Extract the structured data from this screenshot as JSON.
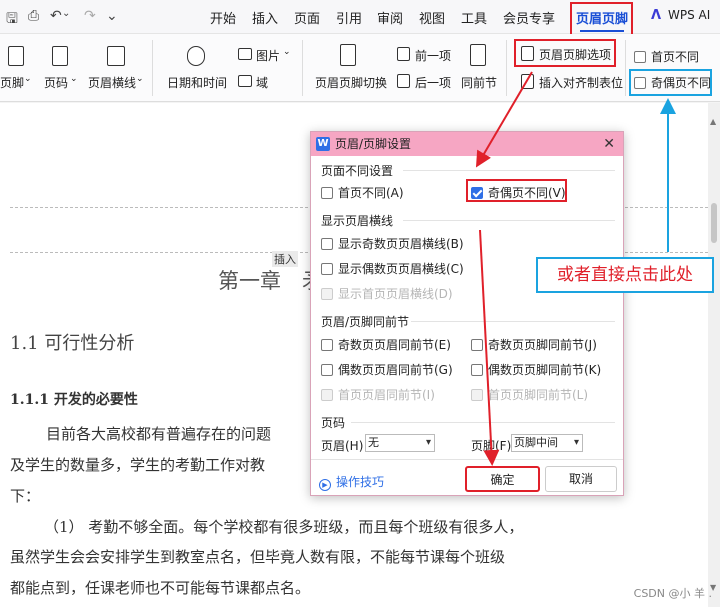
{
  "toolbar": {
    "quick_access": [
      "🖫",
      "↶",
      "⌄",
      "↷",
      "⌄"
    ],
    "tabs": [
      "开始",
      "插入",
      "页面",
      "引用",
      "审阅",
      "视图",
      "工具",
      "会员专享",
      "页眉页脚",
      "WPS AI"
    ],
    "active_tab": "页眉页脚"
  },
  "ribbon": {
    "buttons": [
      "页脚",
      "页码",
      "页眉横线",
      "日期和时间",
      "图片",
      "域",
      "页眉页脚切换",
      "前一项",
      "后一项",
      "同前节",
      "页眉页脚选项",
      "插入对齐制表位",
      "首页不同",
      "奇偶页不同"
    ],
    "dropdown_markers": [
      "⌄",
      "⌄",
      "⌄",
      "⌄"
    ]
  },
  "document": {
    "insert_tag": "插入",
    "chapter_title": "第一章",
    "chapter_title_cut": "矛",
    "h2": "1.1  可行性分析",
    "h3": "1.1.1  开发的必要性",
    "para1_line1": "目前各大高校都有普遍存在的问题",
    "para1_line2": "及学生的数量多，学生的考勤工作对教",
    "para1_line3": "下：",
    "para2_line1": "（1） 考勤不够全面。每个学校都有很多班级，而且每个班级有很多人，",
    "para2_line2": "虽然学生会会安排学生到教室点名，但毕竟人数有限，不能每节课每个班级",
    "para2_line3": "都能点到，任课老师也不可能每节课都点名。"
  },
  "dialog": {
    "title": "页眉/页脚设置",
    "close": "✕",
    "section_diff": "页面不同设置",
    "first_page_diff": "首页不同(A)",
    "odd_even_diff": "奇偶页不同(V)",
    "section_lines": "显示页眉横线",
    "show_odd_line": "显示奇数页页眉横线(B)",
    "show_even_line": "显示偶数页页眉横线(C)",
    "show_first_line": "显示首页页眉横线(D)",
    "section_same": "页眉/页脚同前节",
    "odd_header_same": "奇数页页眉同前节(E)",
    "odd_footer_same": "奇数页页脚同前节(J)",
    "even_header_same": "偶数页页眉同前节(G)",
    "even_footer_same": "偶数页页脚同前节(K)",
    "first_header_same": "首页页眉同前节(I)",
    "first_footer_same": "首页页脚同前节(L)",
    "section_pagenum": "页码",
    "header_label": "页眉(H)",
    "header_value": "无",
    "footer_label": "页脚(F)",
    "footer_value": "页脚中间",
    "tips": "操作技巧",
    "ok": "确定",
    "cancel": "取消"
  },
  "callout": "或者直接点击此处",
  "watermark": "CSDN @小 羊 ."
}
